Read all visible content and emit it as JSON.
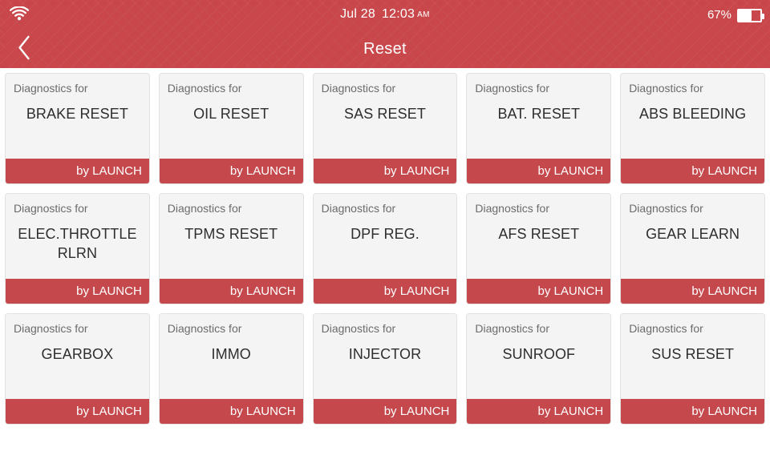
{
  "status_bar": {
    "wifi_icon": "wifi-icon",
    "date": "Jul 28",
    "time": "12:03",
    "meridiem": "AM",
    "battery_percent": "67%",
    "battery_icon": "battery-icon"
  },
  "title_bar": {
    "back_icon": "chevron-left-icon",
    "title": "Reset"
  },
  "theme": {
    "header_red": "#c9474b",
    "footer_red": "#c4484c",
    "card_bg": "#f4f4f4",
    "card_border": "#e2e2e2",
    "page_bg": "#ffffff",
    "sublabel_gray": "#6b6b6b",
    "title_dark": "#2e2e2e"
  },
  "common": {
    "sublabel": "Diagnostics for",
    "footer_label": "by LAUNCH"
  },
  "cards": [
    {
      "sublabel": "Diagnostics for",
      "title": "BRAKE RESET",
      "footer": "by LAUNCH"
    },
    {
      "sublabel": "Diagnostics for",
      "title": "OIL RESET",
      "footer": "by LAUNCH"
    },
    {
      "sublabel": "Diagnostics for",
      "title": "SAS RESET",
      "footer": "by LAUNCH"
    },
    {
      "sublabel": "Diagnostics for",
      "title": "BAT. RESET",
      "footer": "by LAUNCH"
    },
    {
      "sublabel": "Diagnostics for",
      "title": "ABS BLEEDING",
      "footer": "by LAUNCH"
    },
    {
      "sublabel": "Diagnostics for",
      "title": "ELEC.THROTTLE RLRN",
      "footer": "by LAUNCH"
    },
    {
      "sublabel": "Diagnostics for",
      "title": "TPMS RESET",
      "footer": "by LAUNCH"
    },
    {
      "sublabel": "Diagnostics for",
      "title": "DPF REG.",
      "footer": "by LAUNCH"
    },
    {
      "sublabel": "Diagnostics for",
      "title": "AFS RESET",
      "footer": "by LAUNCH"
    },
    {
      "sublabel": "Diagnostics for",
      "title": "GEAR LEARN",
      "footer": "by LAUNCH"
    },
    {
      "sublabel": "Diagnostics for",
      "title": "GEARBOX",
      "footer": "by LAUNCH"
    },
    {
      "sublabel": "Diagnostics for",
      "title": "IMMO",
      "footer": "by LAUNCH"
    },
    {
      "sublabel": "Diagnostics for",
      "title": "INJECTOR",
      "footer": "by LAUNCH"
    },
    {
      "sublabel": "Diagnostics for",
      "title": "SUNROOF",
      "footer": "by LAUNCH"
    },
    {
      "sublabel": "Diagnostics for",
      "title": "SUS RESET",
      "footer": "by LAUNCH"
    }
  ]
}
